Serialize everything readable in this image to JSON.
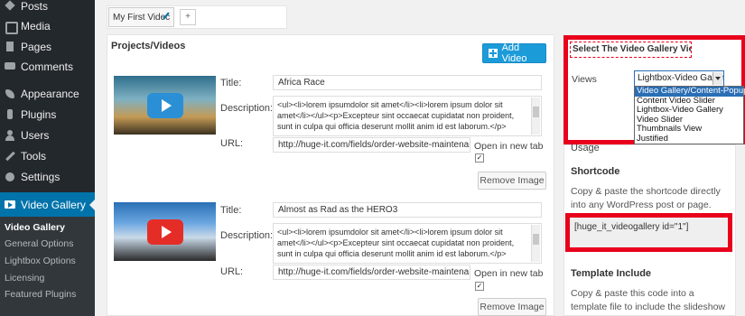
{
  "sidebar": {
    "items": [
      {
        "label": "Posts",
        "icon": "pushpin-icon"
      },
      {
        "label": "Media",
        "icon": "media-icon"
      },
      {
        "label": "Pages",
        "icon": "pages-icon"
      },
      {
        "label": "Comments",
        "icon": "comments-icon"
      },
      {
        "label": "Appearance",
        "icon": "appearance-icon"
      },
      {
        "label": "Plugins",
        "icon": "plugins-icon"
      },
      {
        "label": "Users",
        "icon": "users-icon"
      },
      {
        "label": "Tools",
        "icon": "tools-icon"
      },
      {
        "label": "Settings",
        "icon": "settings-icon"
      },
      {
        "label": "Video Gallery",
        "icon": "video-gallery-icon"
      }
    ],
    "submenu": [
      "Video Gallery",
      "General Options",
      "Lightbox Options",
      "Licensing",
      "Featured Plugins"
    ],
    "active_color": "#0073aa"
  },
  "tabs": {
    "gallery_tab": "My First Videc",
    "add_tab": "+"
  },
  "projects": {
    "title": "Projects/Videos",
    "add_button": "Add Video",
    "labels": {
      "title": "Title:",
      "description": "Description:",
      "url": "URL:",
      "open_new_tab": "Open in new tab",
      "remove": "Remove Image"
    },
    "items": [
      {
        "title": "Africa Race",
        "description": "<ul><li>lorem ipsumdolor sit amet</li><li>lorem ipsum dolor sit amet</li></ul><p>Excepteur sint occaecat cupidatat non proident, sunt in culpa qui officia deserunt mollit anim id est laborum.</p>",
        "url": "http://huge-it.com/fields/order-website-maintenance/",
        "open_new_tab": "✓"
      },
      {
        "title": "Almost as Rad as the HERO3",
        "description": "<ul><li>lorem ipsumdolor sit amet</li><li>lorem ipsum dolor sit amet</li></ul><p>Excepteur sint occaecat cupidatat non proident, sunt in culpa qui officia deserunt mollit anim id est laborum.</p>",
        "url": "http://huge-it.com/fields/order-website-maintenance/",
        "open_new_tab": "✓"
      }
    ]
  },
  "views": {
    "header": "Select The Video Gallery View",
    "label": "Views",
    "selected": "Lightbox-Video Galler",
    "options": [
      "Video Gallery/Content-Popup",
      "Content Video Slider",
      "Lightbox-Video Gallery",
      "Video Slider",
      "Thumbnails View",
      "Justified"
    ],
    "highlight_color": "#e8001c"
  },
  "usage": {
    "title": "Usage",
    "shortcode_title": "Shortcode",
    "shortcode_text": "Copy & paste the shortcode directly into any WordPress post or page.",
    "shortcode_code": "[huge_it_videogallery id=\"1\"]",
    "template_title": "Template Include",
    "template_text": "Copy & paste this code into a template file to include the slideshow within your theme."
  }
}
